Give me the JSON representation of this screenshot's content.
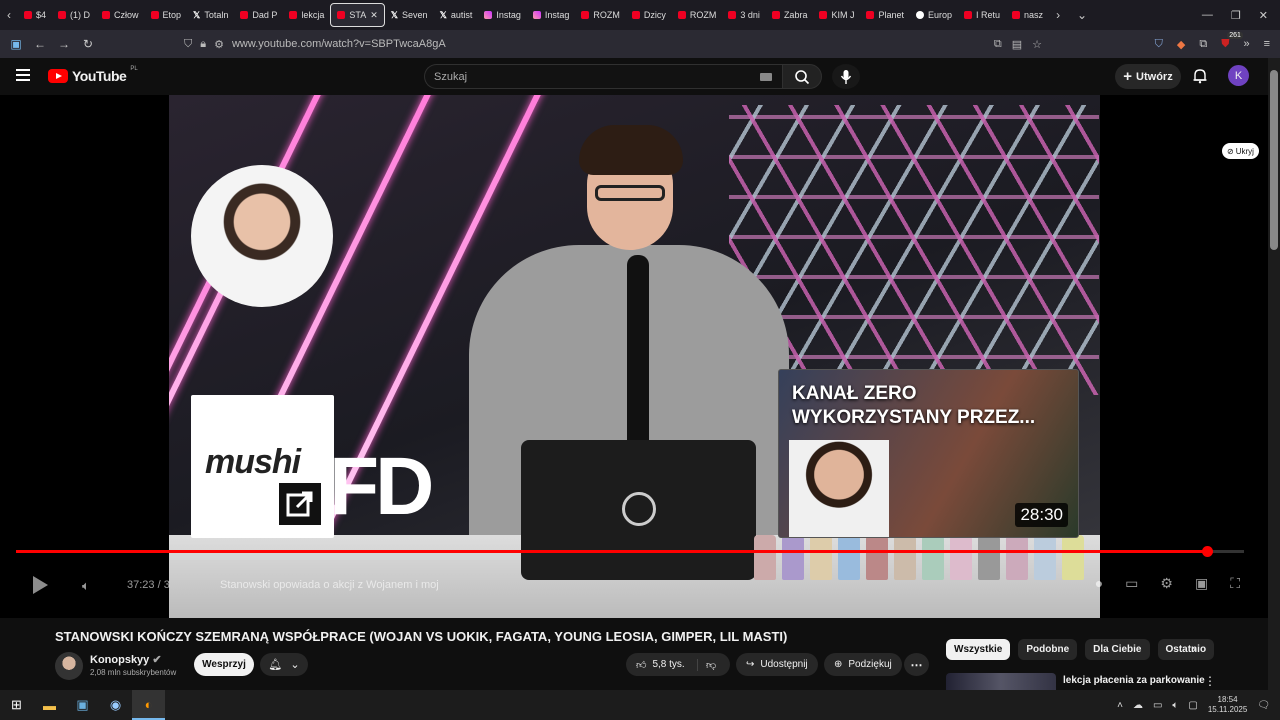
{
  "browser": {
    "tabs": [
      {
        "label": "$4",
        "icon": "youtube"
      },
      {
        "label": "(1) D",
        "icon": "youtube"
      },
      {
        "label": "Człow",
        "icon": "youtube"
      },
      {
        "label": "Etop",
        "icon": "youtube"
      },
      {
        "label": "Totaln",
        "icon": "x"
      },
      {
        "label": "Dad P",
        "icon": "youtube"
      },
      {
        "label": "lekcja",
        "icon": "youtube"
      },
      {
        "label": "STA",
        "icon": "youtube",
        "active": true
      },
      {
        "label": "Seven",
        "icon": "x"
      },
      {
        "label": "autist",
        "icon": "x"
      },
      {
        "label": "Instag",
        "icon": "instagram"
      },
      {
        "label": "Instag",
        "icon": "instagram"
      },
      {
        "label": "ROZM",
        "icon": "youtube"
      },
      {
        "label": "Dzicy",
        "icon": "youtube"
      },
      {
        "label": "ROZM",
        "icon": "youtube"
      },
      {
        "label": "3 dni",
        "icon": "youtube"
      },
      {
        "label": "Zabra",
        "icon": "youtube"
      },
      {
        "label": "KIM J",
        "icon": "youtube"
      },
      {
        "label": "Planet",
        "icon": "youtube"
      },
      {
        "label": "Europ",
        "icon": "globe"
      },
      {
        "label": "I Retu",
        "icon": "youtube"
      },
      {
        "label": "nasz",
        "icon": "youtube"
      }
    ],
    "url": "www.youtube.com/watch?v=SBPTwcaA8gA",
    "badge_count": "261"
  },
  "youtube": {
    "logo_text": "YouTube",
    "logo_region": "PL",
    "search_placeholder": "Szukaj",
    "create_label": "Utwórz",
    "avatar_letter": "K"
  },
  "player": {
    "mushi_text": "mushi",
    "fd_text": "FD",
    "endcard_title": "KANAŁ ZERO WYKORZYSTANY PRZEZ...",
    "endcard_duration": "28:30",
    "hide_label": "Ukryj",
    "time_text": "37:23 / 3",
    "chapter_text": "Stanowski opowiada o akcji z Wojanem i moj",
    "progress": 0.97
  },
  "video": {
    "title": "STANOWSKI KOŃCZY SZEMRANĄ WSPÓŁPRACE (WOJAN VS UOKIK, FAGATA, YOUNG LEOSIA, GIMPER, LIL MASTI)",
    "channel": "Konopskyy",
    "subscribers": "2,08 mln subskrybentów",
    "support_label": "Wesprzyj",
    "likes": "5,8 tys.",
    "share_label": "Udostępnij",
    "thanks_label": "Podziękuj"
  },
  "sidebar": {
    "chips": [
      "Wszystkie",
      "Podobne",
      "Dla Ciebie",
      "Ostatnio"
    ],
    "rec_title": "lekcja płacenia za parkowanie"
  },
  "taskbar": {
    "time": "18:54",
    "date": "15.11.2025"
  }
}
